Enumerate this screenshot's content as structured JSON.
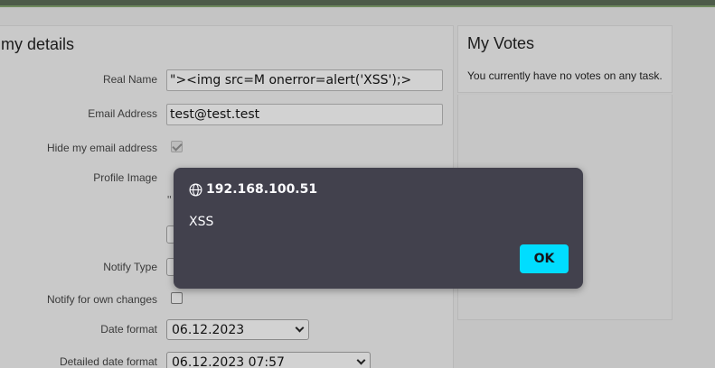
{
  "details": {
    "title": "my details",
    "real_name": {
      "label": "Real Name",
      "value": "\"><img src=M onerror=alert('XSS');>"
    },
    "email": {
      "label": "Email Address",
      "value": "test@test.test"
    },
    "hide_email": {
      "label": "Hide my email address",
      "checked": true
    },
    "profile_image": {
      "label": "Profile Image",
      "fragment": "\""
    },
    "notify_type": {
      "label": "Notify Type"
    },
    "notify_own": {
      "label": "Notify for own changes",
      "checked": false
    },
    "date_format": {
      "label": "Date format",
      "value": "06.12.2023"
    },
    "detailed_date_format": {
      "label": "Detailed date format",
      "value": "06.12.2023 07:57"
    }
  },
  "votes": {
    "title": "My Votes",
    "text": "You currently have no votes on any task."
  },
  "dialog": {
    "origin": "192.168.100.51",
    "message": "XSS",
    "ok_label": "OK",
    "icon": "globe-icon"
  },
  "colors": {
    "dialog_bg": "#42414d",
    "ok_button": "#00ddff",
    "topbar": "#4d5b49"
  }
}
